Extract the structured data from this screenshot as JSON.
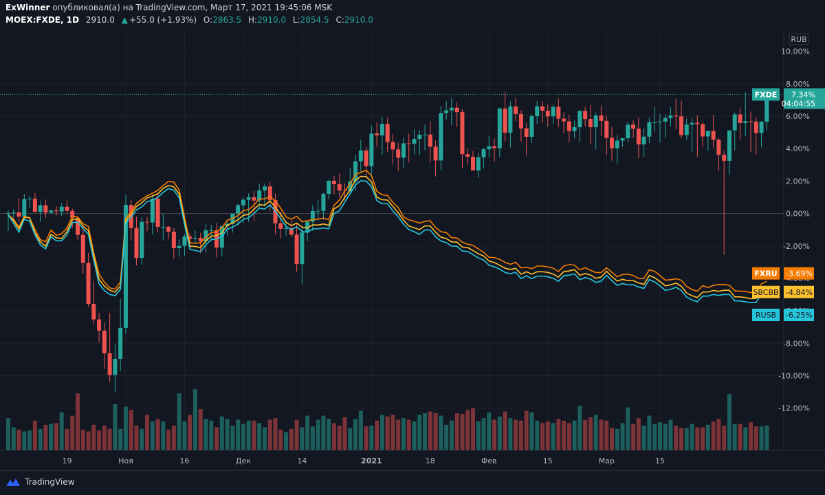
{
  "header": {
    "author": "ExWinner",
    "published": "опубликовал(а) на TradingView.com, Март 17, 2021 19:45:06 MSK",
    "symbol": "MOEX:FXDE, 1D",
    "last": "2910.0",
    "change": "+55.0 (+1.93%)",
    "o_label": "O:",
    "o": "2863.5",
    "h_label": "H:",
    "h": "2910.0",
    "l_label": "L:",
    "l": "2854.5",
    "c_label": "C:",
    "c": "2910.0"
  },
  "footer": {
    "brand": "TradingView"
  },
  "chart_data": {
    "type": "line",
    "currency_label": "RUB",
    "y_ticks": [
      "10.00%",
      "8.00%",
      "6.00%",
      "4.00%",
      "2.00%",
      "0.00%",
      "-2.00%",
      "-4.00%",
      "-6.00%",
      "-8.00%",
      "-10.00%",
      "-12.00%"
    ],
    "ylim": [
      -14.6,
      11.3
    ],
    "x_labels": [
      {
        "label": "19",
        "i": 11
      },
      {
        "label": "Ноя",
        "i": 22
      },
      {
        "label": "16",
        "i": 33
      },
      {
        "label": "Дек",
        "i": 44
      },
      {
        "label": "14",
        "i": 55
      },
      {
        "label": "2021",
        "i": 68
      },
      {
        "label": "18",
        "i": 79
      },
      {
        "label": "Фев",
        "i": 90
      },
      {
        "label": "15",
        "i": 101
      },
      {
        "label": "Мар",
        "i": 112
      },
      {
        "label": "15",
        "i": 122
      }
    ],
    "last_price_value": 7.34,
    "colors": {
      "up": "#26a69a",
      "down": "#ef5350",
      "vol_up": "#1d5f5c",
      "vol_down": "#7d3438",
      "FXRU": "#f57c00",
      "SBCBB": "#fbc02d",
      "RUSB": "#26c6da",
      "grid": "#1e222d",
      "text": "#b2b5be",
      "zero": "#434651"
    },
    "candles": {
      "open": [
        0.0,
        0.02,
        0.07,
        -0.19,
        0.89,
        0.92,
        0.1,
        0.51,
        0.06,
        0.19,
        0.13,
        0.42,
        0.16,
        -0.27,
        -1.32,
        -3.04,
        -5.57,
        -6.53,
        -7.22,
        -8.62,
        -9.95,
        -8.96,
        -7.05,
        0.53,
        -0.89,
        -2.74,
        -0.51,
        -0.55,
        0.91,
        -0.82,
        -0.82,
        -1.12,
        -2.14,
        -2.0,
        -1.42,
        -1.55,
        -1.5,
        -1.71,
        -1.03,
        -1.03,
        -2.1,
        -0.78,
        -0.64,
        0.0,
        0.51,
        0.85,
        1.0,
        0.8,
        1.42,
        1.67,
        0.83,
        -0.6,
        -0.94,
        -0.91,
        -1.3,
        -3.12,
        -1.17,
        -0.5,
        0.16,
        0.16,
        1.21,
        2.02,
        1.81,
        1.42,
        1.38,
        1.98,
        3.22,
        3.89,
        2.92,
        4.93,
        4.82,
        5.53,
        4.41,
        3.95,
        3.44,
        4.33,
        4.3,
        4.6,
        4.86,
        4.87,
        4.12,
        3.27,
        6.19,
        6.36,
        6.52,
        6.25,
        3.66,
        3.5,
        2.66,
        3.47,
        3.96,
        4.15,
        4.04,
        6.47,
        4.98,
        6.6,
        6.13,
        5.25,
        4.73,
        6.0,
        6.61,
        6.34,
        5.99,
        6.58,
        5.85,
        5.68,
        5.08,
        5.32,
        6.33,
        5.83,
        5.32,
        6.05,
        5.71,
        4.66,
        4.03,
        4.5,
        4.64,
        5.48,
        5.23,
        4.26,
        4.74,
        5.62,
        5.62,
        5.67,
        5.89,
        6.05,
        5.99,
        4.84,
        5.48,
        5.59,
        5.51,
        4.75,
        5.09,
        4.55,
        3.62,
        3.25,
        5.13,
        6.11,
        5.58,
        5.69,
        5.67,
        4.97,
        5.66
      ],
      "high": [
        0.21,
        0.26,
        0.95,
        1.21,
        1.09,
        1.27,
        0.78,
        0.87,
        0.24,
        0.45,
        0.64,
        0.83,
        0.3,
        -0.18,
        -0.77,
        -2.43,
        -4.17,
        -6.11,
        -6.73,
        -6.12,
        -8.06,
        -5.26,
        1.13,
        0.85,
        -0.19,
        -0.22,
        -0.2,
        1.15,
        1.19,
        -0.02,
        -0.74,
        -0.89,
        -1.6,
        -1.27,
        -1.2,
        -1.04,
        -1.19,
        -0.63,
        -0.7,
        -0.57,
        -0.79,
        -0.42,
        -0.1,
        0.6,
        1.02,
        1.25,
        1.38,
        1.85,
        1.87,
        1.94,
        1.22,
        0.11,
        -0.53,
        -0.41,
        -0.65,
        -0.79,
        -0.66,
        0.54,
        0.82,
        1.29,
        2.08,
        2.34,
        2.45,
        1.86,
        2.83,
        3.63,
        4.56,
        4.11,
        5.41,
        5.63,
        5.96,
        5.9,
        4.9,
        4.36,
        4.7,
        4.92,
        5.19,
        5.15,
        5.48,
        5.66,
        4.5,
        6.62,
        6.94,
        7.14,
        6.86,
        6.43,
        4.02,
        3.87,
        3.73,
        4.06,
        4.8,
        4.63,
        6.53,
        7.47,
        6.91,
        7.13,
        6.38,
        5.57,
        6.13,
        6.94,
        6.91,
        6.72,
        6.72,
        7.1,
        6.25,
        6.09,
        5.73,
        6.35,
        6.59,
        6.69,
        6.23,
        6.66,
        6.04,
        5.33,
        4.85,
        4.66,
        5.67,
        5.75,
        5.91,
        5.27,
        5.88,
        6.57,
        6.13,
        6.1,
        6.56,
        7.07,
        6.96,
        5.87,
        5.88,
        6.06,
        5.66,
        5.11,
        6.07,
        4.66,
        3.88,
        4.55,
        6.23,
        6.54,
        7.47,
        6.29,
        5.94,
        5.71,
        6.19
      ],
      "low": [
        -1.07,
        -0.28,
        -0.53,
        -0.41,
        0.33,
        0.1,
        -0.52,
        -0.29,
        -0.04,
        -0.12,
        -0.14,
        -0.01,
        -0.89,
        -1.61,
        -3.71,
        -5.75,
        -6.85,
        -7.96,
        -9.58,
        -10.39,
        -11.0,
        -9.72,
        -7.43,
        -1.67,
        -3.19,
        -3.13,
        -1.09,
        -1.27,
        -1.13,
        -1.66,
        -1.58,
        -2.82,
        -2.68,
        -2.63,
        -2.13,
        -1.88,
        -2.46,
        -2.41,
        -1.7,
        -2.7,
        -2.63,
        -1.35,
        -1.18,
        -0.73,
        -0.57,
        -0.52,
        -0.46,
        0.29,
        0.43,
        0.17,
        -1.26,
        -1.55,
        -1.4,
        -1.47,
        -3.58,
        -4.36,
        -1.7,
        -1.07,
        -0.48,
        -0.39,
        0.89,
        1.19,
        0.99,
        0.88,
        1.18,
        1.37,
        2.52,
        2.29,
        2.18,
        4.14,
        3.63,
        3.8,
        3.07,
        2.61,
        2.84,
        3.17,
        3.66,
        3.61,
        3.89,
        3.17,
        2.29,
        2.68,
        5.79,
        5.43,
        5.32,
        2.82,
        3.01,
        2.73,
        2.19,
        2.8,
        3.47,
        3.21,
        3.49,
        4.47,
        4.07,
        5.69,
        4.42,
        3.58,
        4.34,
        5.53,
        5.6,
        5.36,
        5.5,
        5.33,
        4.94,
        4.36,
        4.63,
        4.41,
        5.36,
        4.27,
        3.95,
        4.78,
        3.61,
        3.26,
        3.08,
        4.1,
        4.37,
        4.65,
        3.41,
        3.48,
        4.34,
        5.04,
        4.37,
        4.64,
        5.38,
        5.22,
        4.64,
        4.53,
        3.79,
        3.49,
        4.13,
        3.88,
        4.04,
        2.65,
        -2.55,
        2.4,
        3.9,
        4.56,
        4.78,
        3.77,
        3.65,
        4.09,
        5.13
      ],
      "close": [
        0.02,
        0.07,
        -0.19,
        0.89,
        0.92,
        0.1,
        0.51,
        0.06,
        0.19,
        0.13,
        0.42,
        0.16,
        -0.27,
        -1.32,
        -3.04,
        -5.57,
        -6.53,
        -7.22,
        -8.62,
        -9.95,
        -8.96,
        -7.05,
        0.53,
        -0.89,
        -2.74,
        -0.51,
        -0.55,
        0.91,
        -0.82,
        -0.82,
        -1.12,
        -2.14,
        -2.0,
        -1.42,
        -1.55,
        -1.5,
        -1.71,
        -1.03,
        -1.03,
        -2.1,
        -0.78,
        -0.64,
        0.0,
        0.51,
        0.85,
        1.0,
        0.8,
        1.42,
        1.67,
        0.83,
        -0.6,
        -0.94,
        -0.91,
        -1.3,
        -3.12,
        -1.17,
        -0.5,
        0.16,
        0.16,
        1.21,
        2.02,
        1.81,
        1.42,
        1.38,
        1.98,
        3.22,
        3.89,
        2.92,
        4.93,
        4.82,
        5.53,
        4.41,
        3.95,
        3.44,
        4.33,
        4.3,
        4.6,
        4.86,
        4.87,
        4.12,
        3.27,
        6.19,
        6.36,
        6.52,
        6.25,
        3.66,
        3.5,
        2.66,
        3.47,
        3.96,
        4.15,
        4.04,
        6.47,
        4.98,
        6.6,
        6.13,
        5.25,
        4.73,
        6.0,
        6.61,
        6.34,
        5.99,
        6.58,
        5.85,
        5.68,
        5.08,
        5.32,
        6.33,
        5.83,
        5.32,
        6.05,
        5.71,
        4.66,
        4.03,
        4.5,
        4.64,
        5.48,
        5.23,
        4.26,
        4.74,
        5.62,
        5.62,
        5.67,
        5.89,
        6.05,
        5.99,
        4.84,
        5.48,
        5.59,
        5.51,
        4.75,
        5.09,
        4.55,
        3.62,
        3.25,
        5.13,
        6.11,
        5.58,
        5.69,
        5.67,
        4.97,
        5.66,
        7.34
      ],
      "volume_ratio": [
        0.39,
        0.28,
        0.25,
        0.23,
        0.24,
        0.36,
        0.26,
        0.31,
        0.32,
        0.33,
        0.46,
        0.26,
        0.42,
        0.69,
        0.25,
        0.23,
        0.31,
        0.24,
        0.3,
        0.26,
        0.56,
        0.26,
        0.53,
        0.49,
        0.3,
        0.26,
        0.43,
        0.35,
        0.38,
        0.35,
        0.25,
        0.3,
        0.69,
        0.35,
        0.43,
        0.74,
        0.5,
        0.38,
        0.36,
        0.28,
        0.41,
        0.38,
        0.3,
        0.37,
        0.32,
        0.36,
        0.36,
        0.33,
        0.28,
        0.37,
        0.39,
        0.25,
        0.22,
        0.26,
        0.37,
        0.28,
        0.42,
        0.29,
        0.37,
        0.42,
        0.38,
        0.33,
        0.3,
        0.4,
        0.27,
        0.38,
        0.48,
        0.29,
        0.3,
        0.36,
        0.43,
        0.41,
        0.43,
        0.37,
        0.39,
        0.37,
        0.35,
        0.43,
        0.45,
        0.47,
        0.45,
        0.42,
        0.31,
        0.36,
        0.45,
        0.44,
        0.49,
        0.51,
        0.35,
        0.39,
        0.46,
        0.37,
        0.41,
        0.47,
        0.39,
        0.37,
        0.36,
        0.48,
        0.46,
        0.36,
        0.33,
        0.35,
        0.33,
        0.38,
        0.36,
        0.33,
        0.36,
        0.54,
        0.37,
        0.4,
        0.43,
        0.37,
        0.36,
        0.27,
        0.26,
        0.33,
        0.52,
        0.32,
        0.39,
        0.3,
        0.42,
        0.32,
        0.34,
        0.32,
        0.37,
        0.3,
        0.27,
        0.27,
        0.32,
        0.28,
        0.28,
        0.31,
        0.35,
        0.38,
        0.3,
        0.68,
        0.32,
        0.32,
        0.28,
        0.34,
        0.29,
        0.29,
        0.3
      ]
    },
    "series": [
      {
        "name": "FXRU",
        "last_label": "-3.69%",
        "value": -3.69,
        "values": [
          -0.07,
          -0.35,
          -0.84,
          -0.17,
          -0.28,
          -0.98,
          -1.61,
          -1.74,
          -1.02,
          -1.34,
          -1.24,
          -0.89,
          -0.18,
          -0.21,
          -0.62,
          -0.8,
          -2.42,
          -3.74,
          -4.23,
          -4.58,
          -4.67,
          -4.22,
          -0.29,
          0.1,
          0.63,
          0.87,
          1.1,
          1.25,
          1.43,
          1.72,
          1.98,
          1.93,
          1.45,
          -0.22,
          -1.8,
          -1.84,
          -1.79,
          -1.47,
          -1.17,
          -1.12,
          -0.88,
          -0.41,
          -0.3,
          -0.13,
          0.18,
          0.24,
          0.52,
          0.9,
          0.9,
          1.05,
          0.77,
          0.33,
          -0.2,
          -0.35,
          -0.17,
          -0.51,
          -0.44,
          -0.38,
          -0.34,
          -0.28,
          -0.39,
          0.52,
          0.83,
          1.38,
          1.84,
          2.4,
          2.54,
          2.67,
          2.33,
          1.37,
          1.16,
          1.11,
          0.69,
          0.37,
          -0.21,
          -0.39,
          -0.48,
          -0.59,
          -0.48,
          -0.45,
          -0.86,
          -1.12,
          -1.18,
          -1.49,
          -1.51,
          -1.77,
          -1.89,
          -1.96,
          -2.18,
          -2.39,
          -2.7,
          -2.71,
          -2.83,
          -3.01,
          -3.13,
          -3.01,
          -3.35,
          -3.32,
          -3.4,
          -3.24,
          -3.24,
          -3.29,
          -3.37,
          -3.58,
          -3.24,
          -3.15,
          -3.18,
          -3.47,
          -3.34,
          -3.5,
          -3.64,
          -3.64,
          -3.35,
          -3.62,
          -3.9,
          -3.76,
          -3.74,
          -3.82,
          -4.0,
          -4.0,
          -3.47,
          -3.56,
          -3.83,
          -4.11,
          -4.08,
          -4.03,
          -4.11,
          -4.5,
          -4.69,
          -4.79,
          -4.45,
          -4.56,
          -4.43,
          -4.38,
          -4.37,
          -4.43,
          -4.76,
          -4.79,
          -4.79,
          -4.88,
          -4.83,
          -4.33,
          -4.18
        ]
      },
      {
        "name": "SBCBB",
        "last_label": "-4.84%",
        "value": -4.84,
        "values": [
          -0.11,
          -0.45,
          -0.95,
          -0.24,
          -0.25,
          -1.18,
          -1.75,
          -2.02,
          -1.28,
          -1.5,
          -1.54,
          -1.12,
          -0.37,
          -0.32,
          -0.78,
          -1.06,
          -2.6,
          -4.06,
          -4.48,
          -4.73,
          -4.85,
          -4.47,
          -0.44,
          -0.04,
          0.44,
          0.66,
          0.97,
          1.08,
          1.22,
          1.55,
          1.73,
          1.64,
          1.2,
          -0.47,
          -2.02,
          -2.03,
          -2.11,
          -1.68,
          -1.4,
          -1.36,
          -1.2,
          -0.72,
          -0.58,
          -0.39,
          -0.11,
          -0.06,
          0.27,
          0.55,
          0.51,
          0.78,
          0.38,
          -0.05,
          -0.54,
          -0.75,
          -0.59,
          -0.84,
          -0.89,
          -0.7,
          -0.71,
          -0.64,
          -0.73,
          0.29,
          0.48,
          0.99,
          1.45,
          2.06,
          2.29,
          2.28,
          1.95,
          1.01,
          0.85,
          0.83,
          0.45,
          0.04,
          -0.41,
          -0.77,
          -0.88,
          -0.99,
          -0.76,
          -0.77,
          -1.15,
          -1.46,
          -1.54,
          -1.75,
          -1.76,
          -2.07,
          -2.1,
          -2.28,
          -2.48,
          -2.62,
          -2.93,
          -3.02,
          -3.19,
          -3.37,
          -3.45,
          -3.38,
          -3.74,
          -3.59,
          -3.74,
          -3.59,
          -3.59,
          -3.63,
          -3.73,
          -3.92,
          -3.58,
          -3.54,
          -3.46,
          -3.81,
          -3.7,
          -3.79,
          -4.0,
          -3.91,
          -3.56,
          -3.89,
          -4.16,
          -4.06,
          -4.14,
          -4.14,
          -4.28,
          -4.37,
          -3.82,
          -3.96,
          -4.19,
          -4.46,
          -4.4,
          -4.29,
          -4.48,
          -4.9,
          -5.07,
          -5.18,
          -4.84,
          -4.84,
          -4.74,
          -4.8,
          -4.73,
          -4.73,
          -5.14,
          -5.14,
          -5.18,
          -5.25,
          -5.23,
          -4.7,
          -4.58
        ]
      },
      {
        "name": "RUSB",
        "last_label": "-6.25%",
        "value": -6.25,
        "values": [
          -0.07,
          -0.61,
          -1.15,
          -0.35,
          -0.48,
          -1.31,
          -1.93,
          -2.18,
          -1.43,
          -1.68,
          -1.68,
          -1.31,
          -0.57,
          -0.52,
          -0.94,
          -1.28,
          -2.88,
          -4.34,
          -4.75,
          -4.99,
          -5.07,
          -4.68,
          -0.6,
          -0.23,
          0.22,
          0.41,
          0.73,
          0.82,
          0.99,
          1.3,
          1.54,
          1.43,
          0.97,
          -0.68,
          -2.2,
          -2.28,
          -2.35,
          -1.93,
          -1.61,
          -1.57,
          -1.4,
          -0.97,
          -0.84,
          -0.65,
          -0.36,
          -0.26,
          0.0,
          0.33,
          0.27,
          0.53,
          0.14,
          -0.31,
          -0.8,
          -0.99,
          -0.81,
          -1.1,
          -1.16,
          -0.95,
          -0.94,
          -0.89,
          -0.94,
          0.0,
          0.17,
          0.71,
          1.22,
          1.76,
          2.02,
          2.0,
          1.66,
          0.79,
          0.61,
          0.6,
          0.16,
          -0.2,
          -0.66,
          -0.99,
          -1.12,
          -1.29,
          -1.01,
          -1.02,
          -1.43,
          -1.7,
          -1.79,
          -2.01,
          -2.02,
          -2.31,
          -2.34,
          -2.53,
          -2.74,
          -2.87,
          -3.19,
          -3.29,
          -3.43,
          -3.64,
          -3.71,
          -3.62,
          -4.02,
          -3.84,
          -4.01,
          -3.86,
          -3.86,
          -3.9,
          -3.99,
          -4.18,
          -3.84,
          -3.8,
          -3.72,
          -4.08,
          -3.95,
          -4.04,
          -4.25,
          -4.17,
          -3.81,
          -4.14,
          -4.43,
          -4.32,
          -4.4,
          -4.39,
          -4.53,
          -4.62,
          -4.07,
          -4.22,
          -4.46,
          -4.74,
          -4.67,
          -4.55,
          -4.74,
          -5.15,
          -5.33,
          -5.44,
          -5.09,
          -5.09,
          -4.99,
          -5.05,
          -4.99,
          -4.99,
          -5.39,
          -5.39,
          -5.44,
          -5.5,
          -5.48,
          -4.96,
          -4.84
        ]
      }
    ],
    "fxde_label": {
      "name": "FXDE",
      "value": "7.34%",
      "timer": "04:04:55"
    }
  }
}
